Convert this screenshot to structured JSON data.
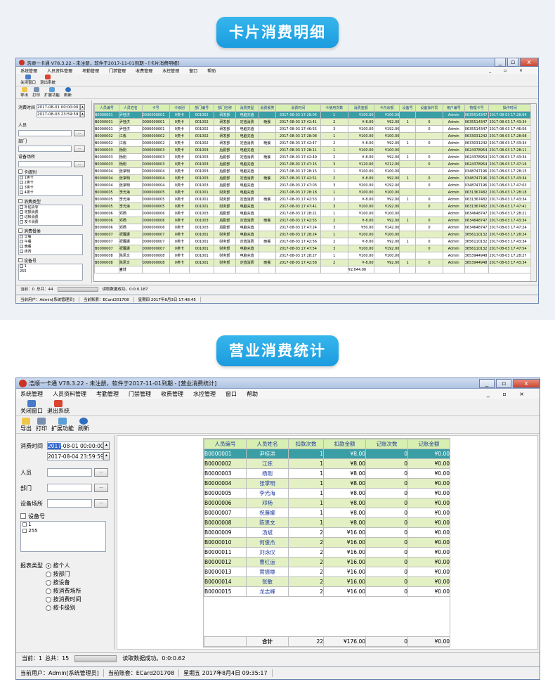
{
  "section1": {
    "heading": "卡片消费明细"
  },
  "section2": {
    "heading": "营业消费统计"
  },
  "colors": {
    "selected": "#3a9ea5",
    "header": "#d7efb0",
    "stripe": "#e3f0c4",
    "pill": "#1a9bde"
  },
  "win1": {
    "title": "浩顺一卡通 V78.3.22 - 未注册，软件于2017-11-01到期 - [卡片消费明细]",
    "menu": [
      "系统管理",
      "人员资料管理",
      "考勤管理",
      "门禁管理",
      "收费管理",
      "水控管理",
      "窗口",
      "帮助"
    ],
    "menu_right": "_ ▫ ×",
    "tb1": [
      "关闭窗口",
      "退出系统"
    ],
    "tb2": [
      "导出",
      "打印",
      "扩展功能",
      "刷新"
    ],
    "filter": {
      "time_label": "消费时间",
      "time_from": "2017-08-01 00:00:00",
      "time_to": "2017-08-03 23:59:59",
      "person": "人员",
      "dept": "部门",
      "place": "设备场所",
      "card_level": "卡级别",
      "card_levels": [
        "1类卡",
        "2类卡",
        "3类卡",
        "4类卡"
      ],
      "consume_type": "消费类型",
      "consume_types": [
        "补贴清零",
        "定额消费",
        "记帐消费",
        "发卡消费"
      ],
      "meal": "消费餐类",
      "meals": [
        "早餐",
        "午餐",
        "晚餐",
        "夜宵"
      ],
      "device": "设备号",
      "devices": [
        "1",
        "255"
      ]
    },
    "columns": [
      "人员编号",
      "人员姓名",
      "卡号",
      "卡级别",
      "部门编号",
      "部门名称",
      "消费类型",
      "消费餐类",
      "消费时间",
      "卡使用次数",
      "消费金额",
      "卡内余额",
      "设备号",
      "设备操作员",
      "用户编号",
      "物理卡号",
      "操作时间"
    ],
    "rows": [
      [
        "B0000001",
        "尹桂洪",
        "0000000001",
        "0类卡",
        "001002",
        "研发部",
        "电脑充值",
        "",
        "2017-08-03 17:28:04",
        "1",
        "¥100.00",
        "¥100.00",
        "",
        "",
        "Admin",
        "0635514347",
        "2017-08-03 17:28:04"
      ],
      [
        "B0000001",
        "尹桂洪",
        "0000000001",
        "0类卡",
        "001002",
        "研发部",
        "定值消费",
        "晚餐",
        "2017-08-03 17:42:41",
        "2",
        "¥-8.00",
        "¥92.00",
        "1",
        "0",
        "Admin",
        "0635514347",
        "2017-08-03 17:43:34"
      ],
      [
        "B0000001",
        "尹桂洪",
        "0000000001",
        "0类卡",
        "001002",
        "研发部",
        "电脑充值",
        "",
        "2017-08-03 17:46:55",
        "3",
        "¥100.00",
        "¥192.00",
        "",
        "0",
        "Admin",
        "0635514347",
        "2017-08-03 17:46:56"
      ],
      [
        "B0000002",
        "江炼",
        "0000000002",
        "0类卡",
        "001002",
        "研发部",
        "电脑充值",
        "",
        "2017-08-03 17:28:08",
        "1",
        "¥100.00",
        "¥100.00",
        "",
        "",
        "Admin",
        "0633031242",
        "2017-08-03 17:28:08"
      ],
      [
        "B0000002",
        "江炼",
        "0000000002",
        "0类卡",
        "001002",
        "研发部",
        "定值消费",
        "晚餐",
        "2017-08-03 17:42:47",
        "2",
        "¥-8.00",
        "¥92.00",
        "1",
        "0",
        "Admin",
        "0633031242",
        "2017-08-03 17:43:34"
      ],
      [
        "B0000003",
        "杨刚",
        "0000000003",
        "0类卡",
        "001003",
        "后勤部",
        "电脑充值",
        "",
        "2017-08-03 17:28:11",
        "1",
        "¥100.00",
        "¥100.00",
        "",
        "",
        "Admin",
        "0624378954",
        "2017-08-03 17:28:11"
      ],
      [
        "B0000003",
        "杨刚",
        "0000000003",
        "0类卡",
        "001003",
        "后勤部",
        "定值消费",
        "晚餐",
        "2017-08-03 17:42:49",
        "2",
        "¥-8.00",
        "¥92.00",
        "1",
        "0",
        "Admin",
        "0624378954",
        "2017-08-03 17:43:34"
      ],
      [
        "B0000003",
        "杨刚",
        "0000000003",
        "0类卡",
        "001003",
        "后勤部",
        "电脑充值",
        "",
        "2017-08-03 17:47:15",
        "3",
        "¥120.00",
        "¥212.00",
        "",
        "0",
        "Admin",
        "0624378954",
        "2017-08-03 17:47:16"
      ],
      [
        "B0000004",
        "张掌明",
        "0000000004",
        "0类卡",
        "001003",
        "后勤部",
        "电脑充值",
        "",
        "2017-08-03 17:28:15",
        "1",
        "¥100.00",
        "¥100.00",
        "",
        "",
        "Admin",
        "0348747196",
        "2017-08-03 17:28:15"
      ],
      [
        "B0000004",
        "张掌明",
        "0000000004",
        "0类卡",
        "001003",
        "后勤部",
        "定值消费",
        "晚餐",
        "2017-08-03 17:42:51",
        "2",
        "¥-8.00",
        "¥92.00",
        "1",
        "0",
        "Admin",
        "0348747196",
        "2017-08-03 17:43:34"
      ],
      [
        "B0000004",
        "张掌明",
        "0000000004",
        "0类卡",
        "001003",
        "后勤部",
        "电脑充值",
        "",
        "2017-08-03 17:47:03",
        "3",
        "¥200.00",
        "¥292.00",
        "",
        "0",
        "Admin",
        "0348747196",
        "2017-08-03 17:47:03"
      ],
      [
        "B0000005",
        "李光海",
        "0000000005",
        "0类卡",
        "001001",
        "财务部",
        "电脑充值",
        "",
        "2017-08-03 17:28:18",
        "1",
        "¥100.00",
        "¥100.00",
        "",
        "",
        "Admin",
        "0631367482",
        "2017-08-03 17:28:18"
      ],
      [
        "B0000005",
        "李光海",
        "0000000005",
        "0类卡",
        "001001",
        "财务部",
        "定值消费",
        "晚餐",
        "2017-08-03 17:42:53",
        "2",
        "¥-8.00",
        "¥92.00",
        "1",
        "0",
        "Admin",
        "0631367482",
        "2017-08-03 17:43:34"
      ],
      [
        "B0000005",
        "李光海",
        "0000000005",
        "0类卡",
        "001001",
        "财务部",
        "电脑充值",
        "",
        "2017-08-03 17:47:41",
        "3",
        "¥100.00",
        "¥192.00",
        "",
        "0",
        "Admin",
        "0631367482",
        "2017-08-03 17:47:41"
      ],
      [
        "B0000006",
        "邓杨",
        "0000000006",
        "0类卡",
        "001003",
        "后勤部",
        "电脑充值",
        "",
        "2017-08-03 17:28:21",
        "1",
        "¥100.00",
        "¥100.00",
        "",
        "",
        "Admin",
        "0634648747",
        "2017-08-03 17:28:21"
      ],
      [
        "B0000006",
        "邓杨",
        "0000000006",
        "0类卡",
        "001003",
        "后勤部",
        "定值消费",
        "晚餐",
        "2017-08-03 17:42:55",
        "2",
        "¥-8.00",
        "¥92.00",
        "1",
        "0",
        "Admin",
        "0634648747",
        "2017-08-03 17:43:34"
      ],
      [
        "B0000006",
        "邓杨",
        "0000000006",
        "0类卡",
        "001003",
        "后勤部",
        "电脑充值",
        "",
        "2017-08-03 17:47:24",
        "3",
        "¥50.00",
        "¥142.00",
        "",
        "0",
        "Admin",
        "0634648747",
        "2017-08-03 17:47:24"
      ],
      [
        "B0000007",
        "祝雁娜",
        "0000000007",
        "0类卡",
        "001001",
        "财务部",
        "电脑充值",
        "",
        "2017-08-03 17:28:24",
        "1",
        "¥100.00",
        "¥100.00",
        "",
        "",
        "Admin",
        "3656110132",
        "2017-08-03 17:28:24"
      ],
      [
        "B0000007",
        "祝雁娜",
        "0000000007",
        "0类卡",
        "001001",
        "财务部",
        "定值消费",
        "晚餐",
        "2017-08-03 17:42:56",
        "2",
        "¥-8.00",
        "¥92.00",
        "1",
        "0",
        "Admin",
        "3656110132",
        "2017-08-03 17:43:34"
      ],
      [
        "B0000007",
        "祝雁娜",
        "0000000007",
        "0类卡",
        "001001",
        "财务部",
        "电脑充值",
        "",
        "2017-08-03 17:47:54",
        "3",
        "¥100.00",
        "¥192.00",
        "",
        "0",
        "Admin",
        "3656110132",
        "2017-08-03 17:47:54"
      ],
      [
        "B0000008",
        "陈思文",
        "0000000008",
        "0类卡",
        "001001",
        "财务部",
        "电脑充值",
        "",
        "2017-08-03 17:28:27",
        "1",
        "¥100.00",
        "¥100.00",
        "",
        "",
        "Admin",
        "3653944948",
        "2017-08-03 17:28:27"
      ],
      [
        "B0000008",
        "陈思文",
        "0000000008",
        "0类卡",
        "001001",
        "财务部",
        "定值消费",
        "晚餐",
        "2017-08-03 17:42:58",
        "2",
        "¥-8.00",
        "¥92.00",
        "1",
        "0",
        "Admin",
        "3653944948",
        "2017-08-03 17:43:34"
      ]
    ],
    "total_label": "合计",
    "total_amount": "¥2,044.00",
    "status": {
      "current": "当前：0",
      "total": "总共：44",
      "message": "读取数据成功。0:0:0.187"
    },
    "footer": {
      "user": "当前用户：Admin[系统管理员]",
      "account": "当前账套：ECard201708",
      "date": "星期四 2017年8月3日 17:48:45"
    }
  },
  "win2": {
    "title": "浩顺一卡通 V78.3.22 - 未注册，软件于2017-11-01到期 - [营业消费统计]",
    "menu": [
      "系统管理",
      "人员资料管理",
      "考勤管理",
      "门禁管理",
      "收费管理",
      "水控管理",
      "窗口",
      "帮助"
    ],
    "menu_right": "_ ▫ ×",
    "tb1": [
      "关闭窗口",
      "退出系统"
    ],
    "tb2": [
      "导出",
      "打印",
      "扩展功能",
      "刷新"
    ],
    "filter": {
      "time_label": "消费时间",
      "time_from_sel": "2017",
      "time_from": "-08-01 00:00:00",
      "time_to": "2017-08-04 23:59:59",
      "person": "人员",
      "dept": "部门",
      "place": "设备场所",
      "device": "设备号",
      "devices": [
        "1",
        "255"
      ],
      "report_type": "报表类型",
      "options": [
        "按个人",
        "按部门",
        "按设备",
        "按消费场所",
        "按消费时间",
        "按卡级别"
      ]
    },
    "columns": [
      "人员编号",
      "人员姓名",
      "扣款次数",
      "扣款金额",
      "记账次数",
      "记账金额"
    ],
    "rows": [
      [
        "B0000001",
        "尹桂洪",
        "1",
        "¥8.00",
        "0",
        "¥0.00"
      ],
      [
        "B0000002",
        "江炼",
        "1",
        "¥8.00",
        "0",
        "¥0.00"
      ],
      [
        "B0000003",
        "杨刚",
        "1",
        "¥8.00",
        "0",
        "¥0.00"
      ],
      [
        "B0000004",
        "张掌明",
        "1",
        "¥8.00",
        "0",
        "¥0.00"
      ],
      [
        "B0000005",
        "李光海",
        "1",
        "¥8.00",
        "0",
        "¥0.00"
      ],
      [
        "B0000006",
        "邓杨",
        "1",
        "¥8.00",
        "0",
        "¥0.00"
      ],
      [
        "B0000007",
        "祝雁娜",
        "1",
        "¥8.00",
        "0",
        "¥0.00"
      ],
      [
        "B0000008",
        "陈思文",
        "1",
        "¥8.00",
        "0",
        "¥0.00"
      ],
      [
        "B0000009",
        "汤斌",
        "2",
        "¥16.00",
        "0",
        "¥0.00"
      ],
      [
        "B0000010",
        "何俊杰",
        "2",
        "¥16.00",
        "0",
        "¥0.00"
      ],
      [
        "B0000011",
        "刘泳仪",
        "2",
        "¥16.00",
        "0",
        "¥0.00"
      ],
      [
        "B0000012",
        "曹红运",
        "2",
        "¥16.00",
        "0",
        "¥0.00"
      ],
      [
        "B0000013",
        "黄振雄",
        "2",
        "¥16.00",
        "0",
        "¥0.00"
      ],
      [
        "B0000014",
        "张敏",
        "2",
        "¥16.00",
        "0",
        "¥0.00"
      ],
      [
        "B0000015",
        "龙志峰",
        "2",
        "¥16.00",
        "0",
        "¥0.00"
      ]
    ],
    "total": [
      "合计",
      "22",
      "¥176.00",
      "0",
      "¥0.00"
    ],
    "status": {
      "current": "当前：1",
      "total": "总共：15",
      "message": "读取数据成功。0:0:0.62"
    },
    "footer": {
      "user": "当前用户：Admin[系统管理员]",
      "account": "当前账套：ECard201708",
      "date": "星期五 2017年8月4日 09:35:17"
    }
  }
}
